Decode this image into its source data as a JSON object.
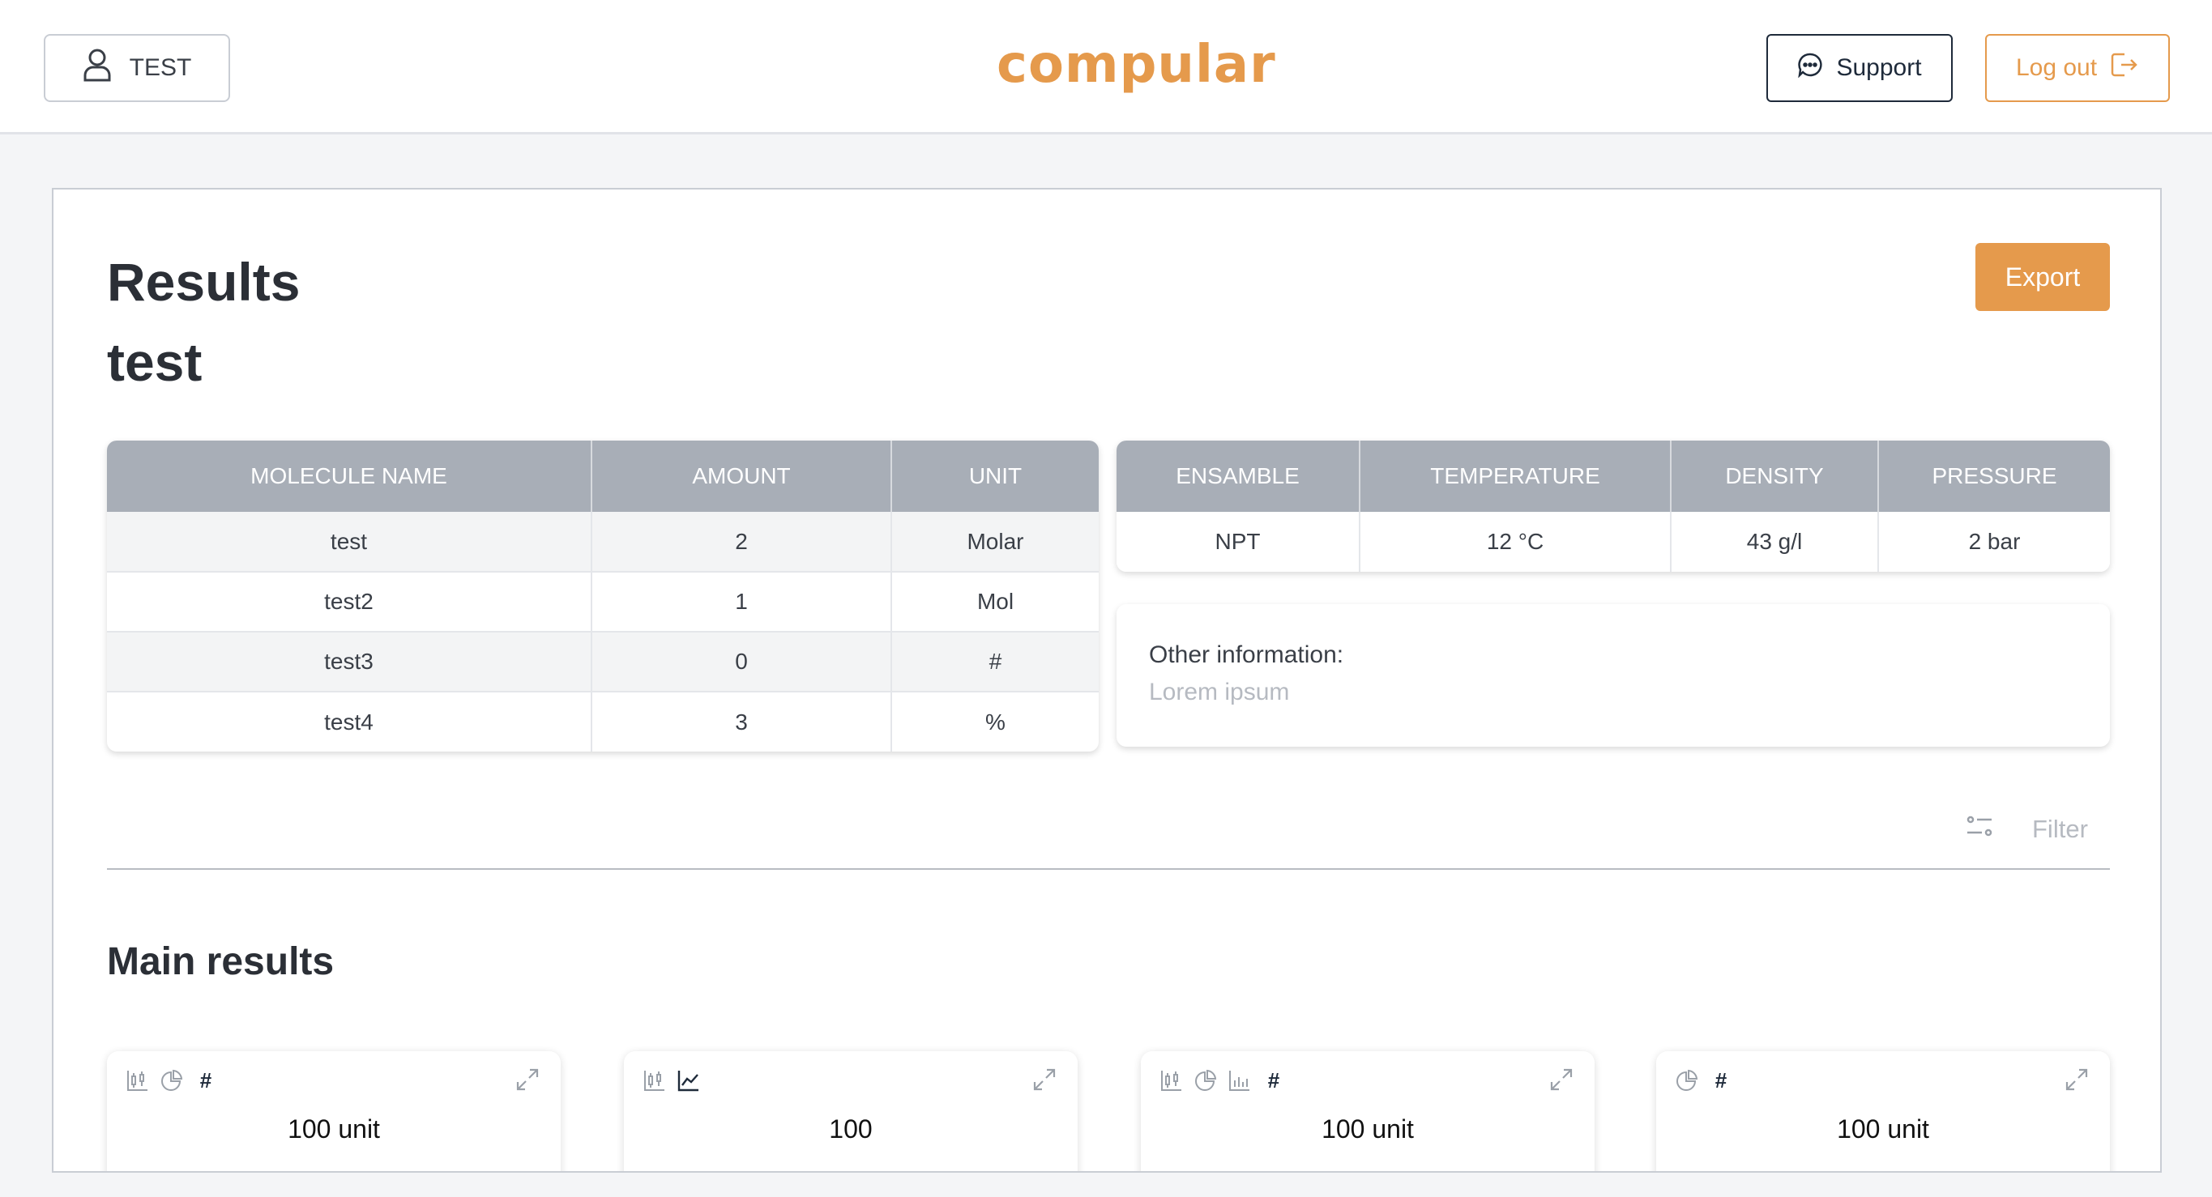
{
  "header": {
    "user_label": "TEST",
    "logo_text": "compular",
    "support_label": "Support",
    "logout_label": "Log out"
  },
  "results": {
    "title": "Results",
    "subtitle": "test",
    "export_label": "Export"
  },
  "molecules": {
    "columns": [
      "MOLECULE NAME",
      "AMOUNT",
      "UNIT"
    ],
    "rows": [
      [
        "test",
        "2",
        "Molar"
      ],
      [
        "test2",
        "1",
        "Mol"
      ],
      [
        "test3",
        "0",
        "#"
      ],
      [
        "test4",
        "3",
        "%"
      ]
    ]
  },
  "conditions": {
    "columns": [
      "ENSAMBLE",
      "TEMPERATURE",
      "DENSITY",
      "PRESSURE"
    ],
    "row": [
      "NPT",
      "12 °C",
      "43 g/l",
      "2 bar"
    ]
  },
  "other_info": {
    "label": "Other information:",
    "value": "Lorem ipsum"
  },
  "filter_label": "Filter",
  "main_results": {
    "title": "Main results",
    "cards": [
      {
        "value": "100 unit",
        "icons": [
          "candlestick-chart-icon",
          "pie-chart-icon",
          "hash-icon"
        ]
      },
      {
        "value": "100",
        "icons": [
          "candlestick-chart-icon",
          "line-chart-icon"
        ]
      },
      {
        "value": "100 unit",
        "icons": [
          "candlestick-chart-icon",
          "pie-chart-icon",
          "bar-chart-icon",
          "hash-icon"
        ]
      },
      {
        "value": "100 unit",
        "icons": [
          "pie-chart-icon",
          "hash-icon"
        ]
      }
    ]
  },
  "colors": {
    "brand": "#e59a4c",
    "dark": "#1e2a3a",
    "table_header": "#a8aeb7"
  }
}
